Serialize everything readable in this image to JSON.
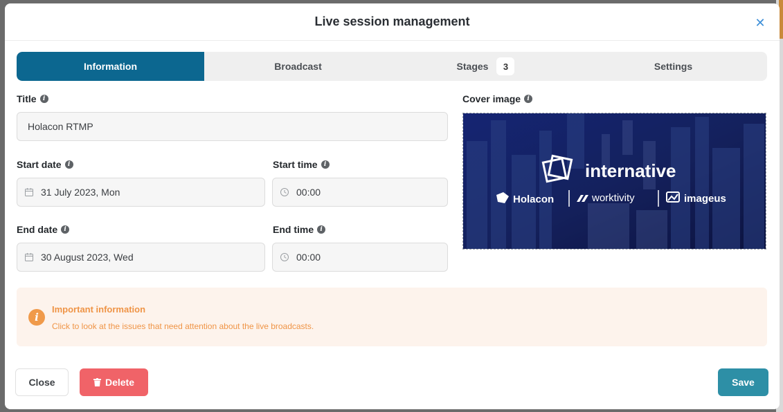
{
  "modal": {
    "title": "Live session management",
    "close_icon": "close-icon"
  },
  "tabs": [
    {
      "label": "Information",
      "active": true
    },
    {
      "label": "Broadcast",
      "active": false
    },
    {
      "label": "Stages",
      "badge": "3",
      "active": false
    },
    {
      "label": "Settings",
      "active": false
    }
  ],
  "form": {
    "title_label": "Title",
    "title_value": "Holacon RTMP",
    "start_date_label": "Start date",
    "start_date_value": "31 July 2023, Mon",
    "start_time_label": "Start time",
    "start_time_value": "00:00",
    "end_date_label": "End date",
    "end_date_value": "30 August 2023, Wed",
    "end_time_label": "End time",
    "end_time_value": "00:00",
    "cover_label": "Cover image"
  },
  "cover": {
    "brand": "internative",
    "partners": [
      "Holacon",
      "worktivity",
      "imageus"
    ]
  },
  "notice": {
    "title": "Important information",
    "text": "Click to look at the issues that need attention about the live broadcasts."
  },
  "buttons": {
    "close": "Close",
    "delete": "Delete",
    "save": "Save"
  },
  "colors": {
    "primary_tab": "#0c6790",
    "delete": "#f06368",
    "save": "#2d8fa6",
    "notice": "#ef9446"
  }
}
